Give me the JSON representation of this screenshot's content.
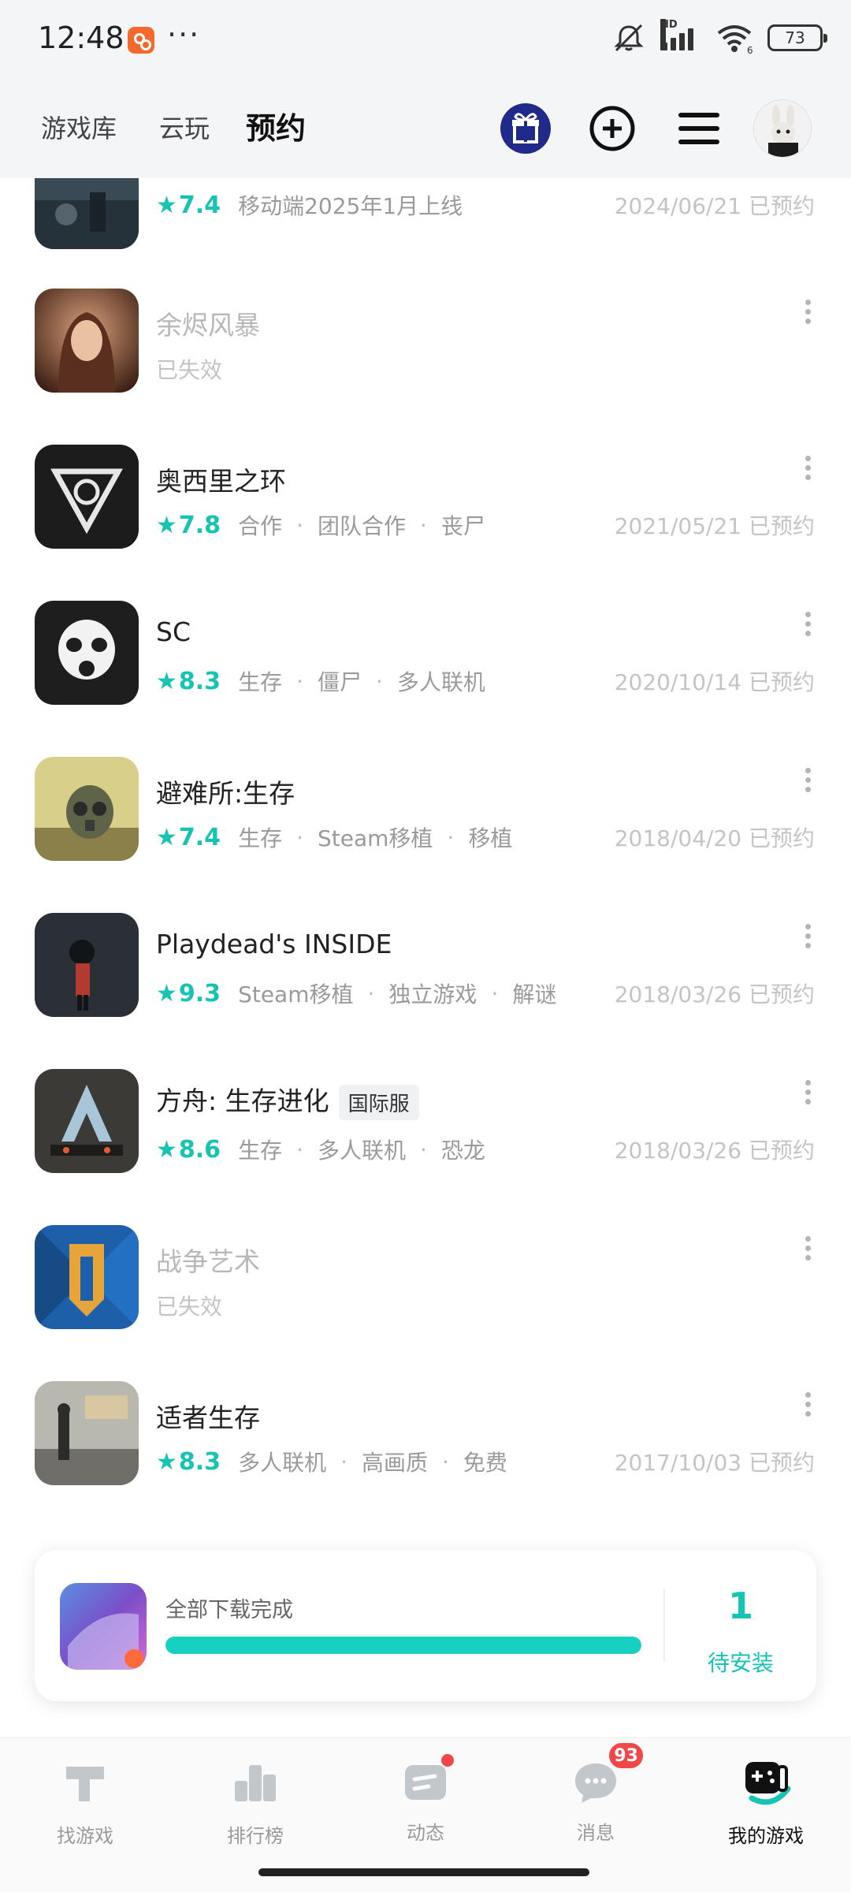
{
  "status_bar": {
    "time": "12:48",
    "more": "···",
    "hd": "HD",
    "wifi_sub": "6",
    "battery": "73"
  },
  "top_nav": {
    "tabs": [
      {
        "label": "游戏库",
        "active": false
      },
      {
        "label": "云玩",
        "active": false
      },
      {
        "label": "预约",
        "active": true
      }
    ],
    "icons": [
      "gift-icon",
      "add-icon",
      "menu-icon",
      "avatar"
    ]
  },
  "games": [
    {
      "name": "",
      "rating": "7.4",
      "tags": [
        "移动端2025年1月上线"
      ],
      "date": "2024/06/21 已预约",
      "expired": false,
      "icon_color": "#3a4a55"
    },
    {
      "name": "余烬风暴",
      "rating": null,
      "tags": [],
      "expired_text": "已失效",
      "expired": true,
      "icon_color": "#7a4a3a"
    },
    {
      "name": "奥西里之环",
      "rating": "7.8",
      "tags": [
        "合作",
        "团队合作",
        "丧尸"
      ],
      "date": "2021/05/21 已预约",
      "expired": false,
      "icon_color": "#1c1c1c"
    },
    {
      "name": "SC",
      "rating": "8.3",
      "tags": [
        "生存",
        "僵尸",
        "多人联机"
      ],
      "date": "2020/10/14 已预约",
      "expired": false,
      "icon_color": "#222222"
    },
    {
      "name": "避难所:生存",
      "rating": "7.4",
      "tags": [
        "生存",
        "Steam移植",
        "移植"
      ],
      "date": "2018/04/20 已预约",
      "expired": false,
      "icon_color": "#c9c27a"
    },
    {
      "name": "Playdead's INSIDE",
      "rating": "9.3",
      "tags": [
        "Steam移植",
        "独立游戏",
        "解谜"
      ],
      "date": "2018/03/26 已预约",
      "expired": false,
      "icon_color": "#2a3036"
    },
    {
      "name": "方舟: 生存进化",
      "badge": "国际服",
      "rating": "8.6",
      "tags": [
        "生存",
        "多人联机",
        "恐龙"
      ],
      "date": "2018/03/26 已预约",
      "expired": false,
      "icon_color": "#3c3a36"
    },
    {
      "name": "战争艺术",
      "rating": null,
      "tags": [],
      "expired_text": "已失效",
      "expired": true,
      "icon_color": "#1d5fa8"
    },
    {
      "name": "适者生存",
      "rating": "8.3",
      "tags": [
        "多人联机",
        "高画质",
        "免费"
      ],
      "date": "2017/10/03 已预约",
      "expired": false,
      "icon_color": "#9a9a94"
    }
  ],
  "download": {
    "title": "全部下载完成",
    "progress": 1.0,
    "count": "1",
    "count_label": "待安装",
    "accent": "#17c3b2"
  },
  "bottom_nav": [
    {
      "label": "找游戏",
      "icon": "find-game-icon",
      "active": false
    },
    {
      "label": "排行榜",
      "icon": "ranking-icon",
      "active": false
    },
    {
      "label": "动态",
      "icon": "feed-icon",
      "active": false,
      "dot": true
    },
    {
      "label": "消息",
      "icon": "message-icon",
      "active": false,
      "badge": "93"
    },
    {
      "label": "我的游戏",
      "icon": "my-games-icon",
      "active": true
    }
  ]
}
